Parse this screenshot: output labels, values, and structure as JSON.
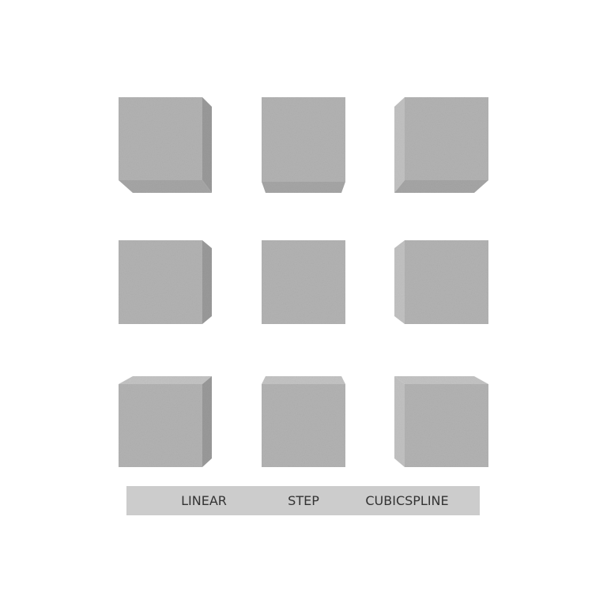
{
  "labels": {
    "linear": "LINEAR",
    "step": "STEP",
    "cubicspline": "CUBICSPLINE"
  },
  "colors": {
    "background": "#ffffff",
    "cube_face": "#b3b3b3",
    "cube_side_light": "#c4c4c4",
    "cube_side_dark": "#9a9a9a",
    "label_bar": "#cccccc",
    "label_text": "#333333"
  }
}
